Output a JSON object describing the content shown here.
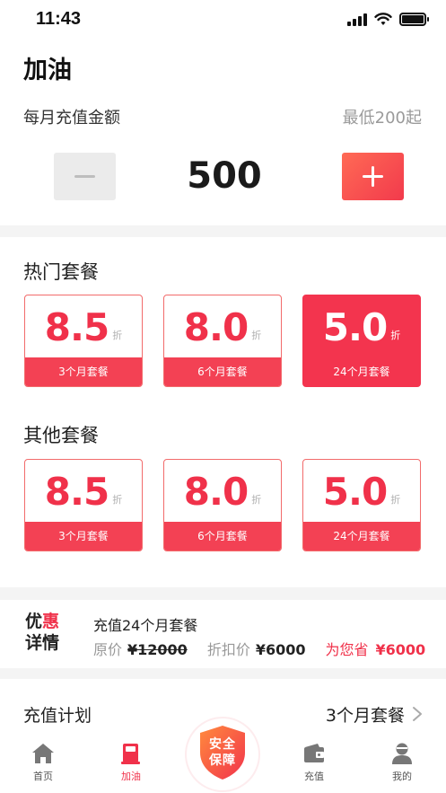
{
  "status_bar": {
    "time": "11:43"
  },
  "page": {
    "title": "加油"
  },
  "amount": {
    "label": "每月充值金额",
    "min_hint": "最低200起",
    "value": "500"
  },
  "hot_packages": {
    "title": "热门套餐",
    "items": [
      {
        "discount": "8.5",
        "unit": "折",
        "name": "3个月套餐",
        "selected": false
      },
      {
        "discount": "8.0",
        "unit": "折",
        "name": "6个月套餐",
        "selected": false
      },
      {
        "discount": "5.0",
        "unit": "折",
        "name": "24个月套餐",
        "selected": true
      }
    ]
  },
  "other_packages": {
    "title": "其他套餐",
    "items": [
      {
        "discount": "8.5",
        "unit": "折",
        "name": "3个月套餐"
      },
      {
        "discount": "8.0",
        "unit": "折",
        "name": "6个月套餐"
      },
      {
        "discount": "5.0",
        "unit": "折",
        "name": "24个月套餐"
      }
    ]
  },
  "promo": {
    "badge_line1_a": "优",
    "badge_line1_b": "惠",
    "badge_line2_a": "详",
    "badge_line2_b": "情",
    "title": "充值24个月套餐",
    "original_label": "原价",
    "original_value": "¥12000",
    "discount_label": "折扣价",
    "discount_value": "¥6000",
    "save_label": "为您省",
    "save_value": "¥6000"
  },
  "plan": {
    "label": "充值计划",
    "value": "3个月套餐"
  },
  "tab_bar": {
    "home": "首页",
    "refuel": "加油",
    "center_line1": "安全",
    "center_line2": "保障",
    "recharge": "充值",
    "mine": "我的"
  },
  "colors": {
    "accent": "#f0314a",
    "accent_light": "#ff6a55"
  }
}
